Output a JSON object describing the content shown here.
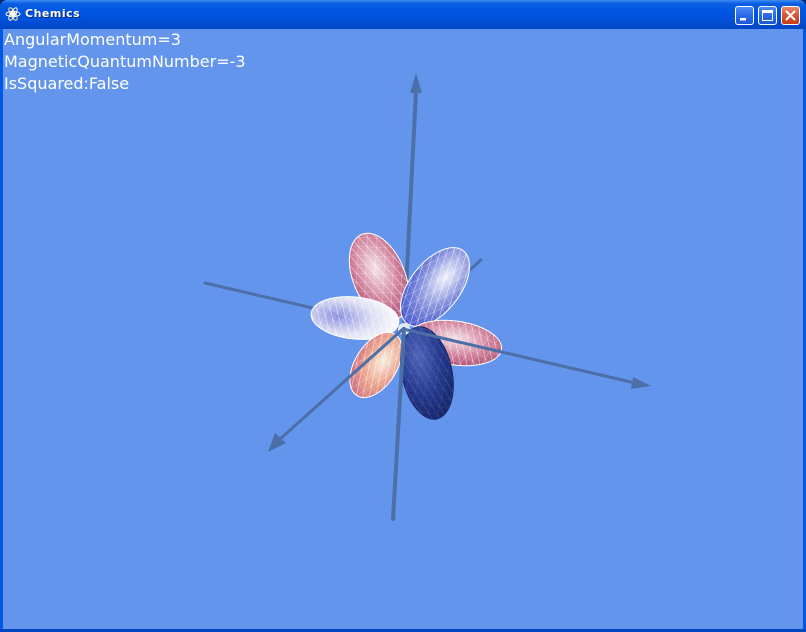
{
  "window": {
    "title": "Chemics",
    "icon": "chemics-app-icon",
    "controls": [
      "minimize-icon",
      "maximize-icon",
      "close-icon"
    ]
  },
  "overlay": {
    "angular_momentum": "AngularMomentum=3",
    "magnetic_quantum_number": "MagneticQuantumNumber=-3",
    "is_squared": "IsSquared:False"
  },
  "colors": {
    "background": "#6495ed",
    "axis": "#4d6fa8",
    "lobe_positive": "#c85a78",
    "lobe_negative": "#3a4fc8",
    "lobe_dark": "#1a2f78",
    "lobe_warm": "#e8a070"
  }
}
